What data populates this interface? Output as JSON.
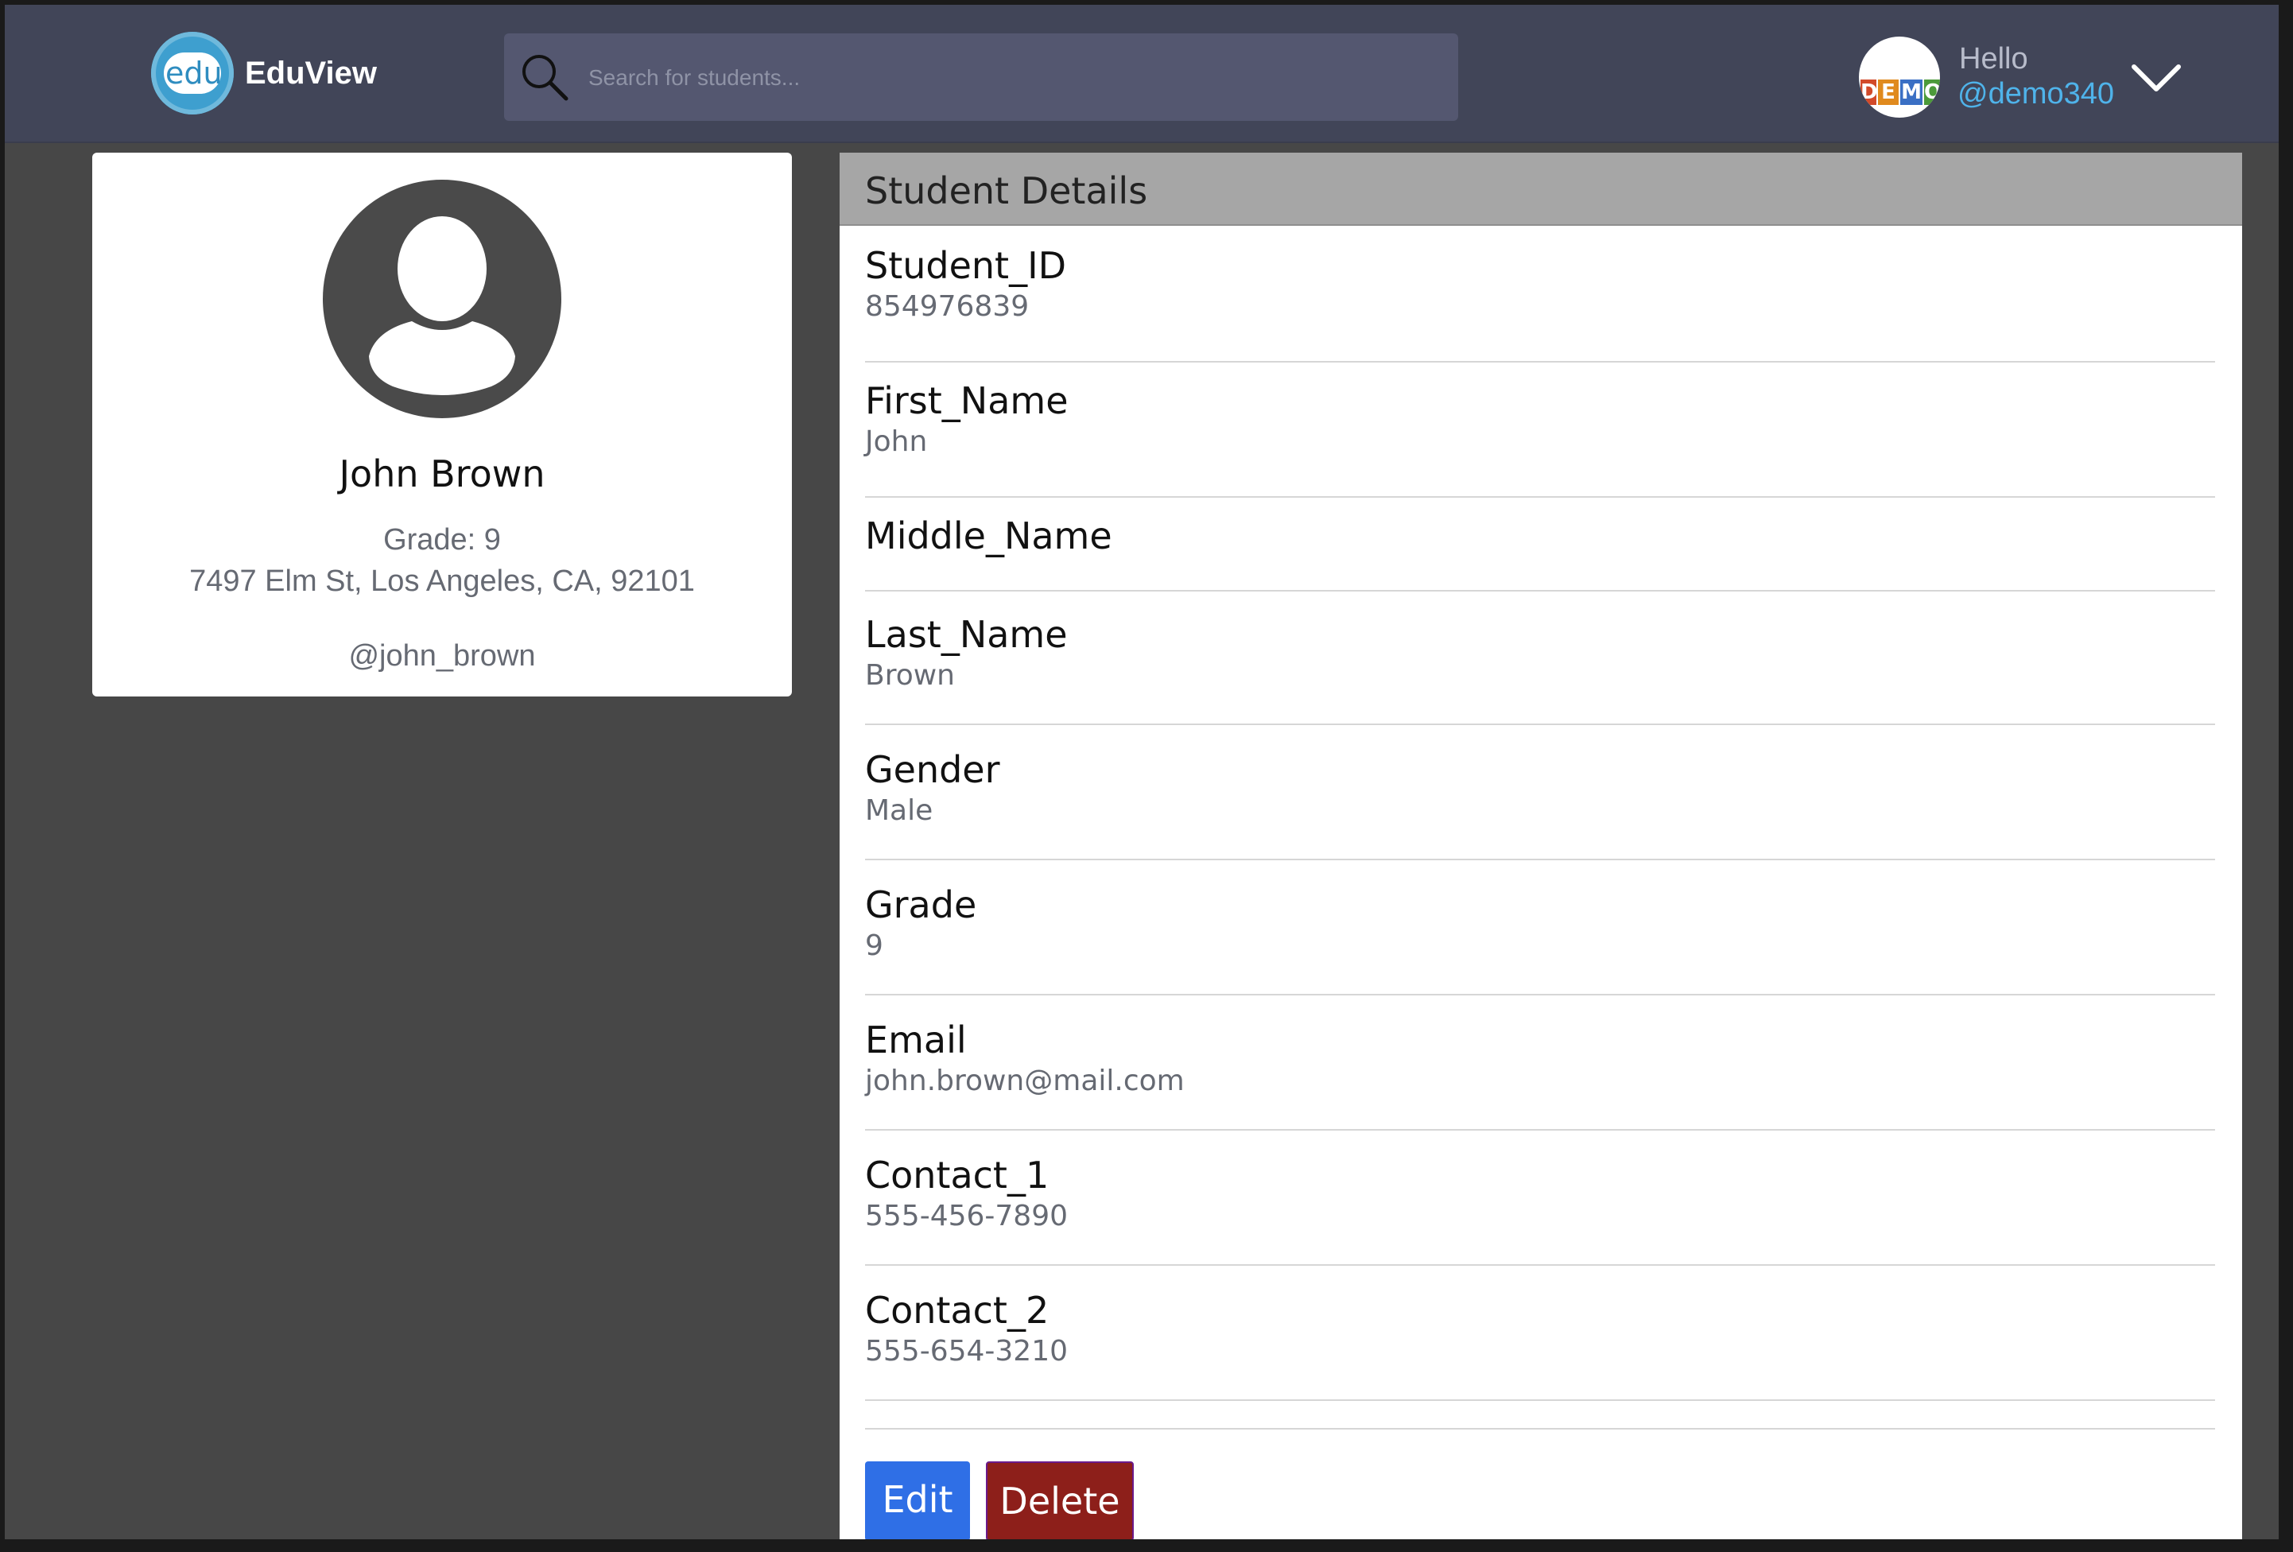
{
  "header": {
    "logo_text": "edu",
    "brand": "EduView",
    "search_placeholder": "Search for students...",
    "greeting": "Hello",
    "username": "@demo340",
    "avatar_letters": [
      "D",
      "E",
      "M",
      "O"
    ]
  },
  "profile": {
    "name": "John Brown",
    "grade_line": "Grade: 9",
    "address": "7497 Elm St, Los Angeles, CA, 92101",
    "username": "@john_brown"
  },
  "details": {
    "title": "Student Details",
    "fields": [
      {
        "label": "Student_ID",
        "value": "854976839"
      },
      {
        "label": "First_Name",
        "value": "John"
      },
      {
        "label": "Middle_Name",
        "value": ""
      },
      {
        "label": "Last_Name",
        "value": "Brown"
      },
      {
        "label": "Gender",
        "value": "Male"
      },
      {
        "label": "Grade",
        "value": "9"
      },
      {
        "label": "Email",
        "value": "john.brown@mail.com"
      },
      {
        "label": "Contact_1",
        "value": "555-456-7890"
      },
      {
        "label": "Contact_2",
        "value": "555-654-3210"
      }
    ],
    "edit_label": "Edit",
    "delete_label": "Delete"
  },
  "colors": {
    "header_bg": "#414558",
    "page_bg": "#474747",
    "link": "#4fb3ea",
    "edit_button": "#2f6fe6",
    "delete_button": "#8d1f1a"
  }
}
